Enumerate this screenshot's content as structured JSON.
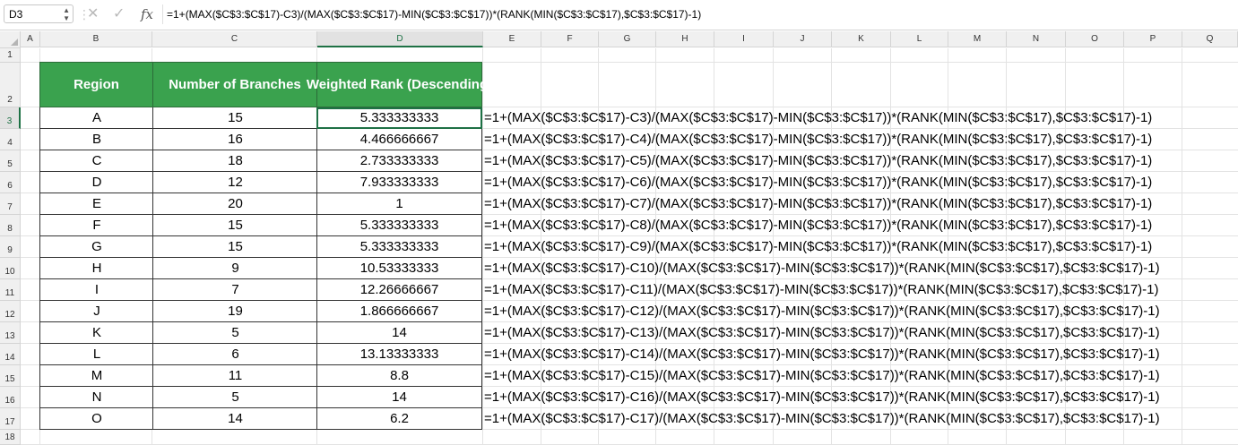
{
  "formula_bar": {
    "name_box": "D3",
    "cancel_icon": "✕",
    "enter_icon": "✓",
    "function_icon": "fx",
    "formula": "=1+(MAX($C$3:$C$17)-C3)/(MAX($C$3:$C$17)-MIN($C$3:$C$17))*(RANK(MIN($C$3:$C$17),$C$3:$C$17)-1)"
  },
  "columns": [
    "A",
    "B",
    "C",
    "D",
    "E",
    "F",
    "G",
    "H",
    "I",
    "J",
    "K",
    "L",
    "M",
    "N",
    "O",
    "P",
    "Q"
  ],
  "selected_column": "D",
  "row_numbers": [
    "1",
    "2",
    "3",
    "4",
    "5",
    "6",
    "7",
    "8",
    "9",
    "10",
    "11",
    "12",
    "13",
    "14",
    "15",
    "16",
    "17",
    "18"
  ],
  "selected_row": "3",
  "table": {
    "headers": {
      "region": "Region",
      "branches": "Number of Branches",
      "rank": "Weighted Rank (Descending)"
    },
    "rows": [
      {
        "region": "A",
        "branches": "15",
        "rank": "5.333333333",
        "formula": "=1+(MAX($C$3:$C$17)-C3)/(MAX($C$3:$C$17)-MIN($C$3:$C$17))*(RANK(MIN($C$3:$C$17),$C$3:$C$17)-1)"
      },
      {
        "region": "B",
        "branches": "16",
        "rank": "4.466666667",
        "formula": "=1+(MAX($C$3:$C$17)-C4)/(MAX($C$3:$C$17)-MIN($C$3:$C$17))*(RANK(MIN($C$3:$C$17),$C$3:$C$17)-1)"
      },
      {
        "region": "C",
        "branches": "18",
        "rank": "2.733333333",
        "formula": "=1+(MAX($C$3:$C$17)-C5)/(MAX($C$3:$C$17)-MIN($C$3:$C$17))*(RANK(MIN($C$3:$C$17),$C$3:$C$17)-1)"
      },
      {
        "region": "D",
        "branches": "12",
        "rank": "7.933333333",
        "formula": "=1+(MAX($C$3:$C$17)-C6)/(MAX($C$3:$C$17)-MIN($C$3:$C$17))*(RANK(MIN($C$3:$C$17),$C$3:$C$17)-1)"
      },
      {
        "region": "E",
        "branches": "20",
        "rank": "1",
        "formula": "=1+(MAX($C$3:$C$17)-C7)/(MAX($C$3:$C$17)-MIN($C$3:$C$17))*(RANK(MIN($C$3:$C$17),$C$3:$C$17)-1)"
      },
      {
        "region": "F",
        "branches": "15",
        "rank": "5.333333333",
        "formula": "=1+(MAX($C$3:$C$17)-C8)/(MAX($C$3:$C$17)-MIN($C$3:$C$17))*(RANK(MIN($C$3:$C$17),$C$3:$C$17)-1)"
      },
      {
        "region": "G",
        "branches": "15",
        "rank": "5.333333333",
        "formula": "=1+(MAX($C$3:$C$17)-C9)/(MAX($C$3:$C$17)-MIN($C$3:$C$17))*(RANK(MIN($C$3:$C$17),$C$3:$C$17)-1)"
      },
      {
        "region": "H",
        "branches": "9",
        "rank": "10.53333333",
        "formula": "=1+(MAX($C$3:$C$17)-C10)/(MAX($C$3:$C$17)-MIN($C$3:$C$17))*(RANK(MIN($C$3:$C$17),$C$3:$C$17)-1)"
      },
      {
        "region": "I",
        "branches": "7",
        "rank": "12.26666667",
        "formula": "=1+(MAX($C$3:$C$17)-C11)/(MAX($C$3:$C$17)-MIN($C$3:$C$17))*(RANK(MIN($C$3:$C$17),$C$3:$C$17)-1)"
      },
      {
        "region": "J",
        "branches": "19",
        "rank": "1.866666667",
        "formula": "=1+(MAX($C$3:$C$17)-C12)/(MAX($C$3:$C$17)-MIN($C$3:$C$17))*(RANK(MIN($C$3:$C$17),$C$3:$C$17)-1)"
      },
      {
        "region": "K",
        "branches": "5",
        "rank": "14",
        "formula": "=1+(MAX($C$3:$C$17)-C13)/(MAX($C$3:$C$17)-MIN($C$3:$C$17))*(RANK(MIN($C$3:$C$17),$C$3:$C$17)-1)"
      },
      {
        "region": "L",
        "branches": "6",
        "rank": "13.13333333",
        "formula": "=1+(MAX($C$3:$C$17)-C14)/(MAX($C$3:$C$17)-MIN($C$3:$C$17))*(RANK(MIN($C$3:$C$17),$C$3:$C$17)-1)"
      },
      {
        "region": "M",
        "branches": "11",
        "rank": "8.8",
        "formula": "=1+(MAX($C$3:$C$17)-C15)/(MAX($C$3:$C$17)-MIN($C$3:$C$17))*(RANK(MIN($C$3:$C$17),$C$3:$C$17)-1)"
      },
      {
        "region": "N",
        "branches": "5",
        "rank": "14",
        "formula": "=1+(MAX($C$3:$C$17)-C16)/(MAX($C$3:$C$17)-MIN($C$3:$C$17))*(RANK(MIN($C$3:$C$17),$C$3:$C$17)-1)"
      },
      {
        "region": "O",
        "branches": "14",
        "rank": "6.2",
        "formula": "=1+(MAX($C$3:$C$17)-C17)/(MAX($C$3:$C$17)-MIN($C$3:$C$17))*(RANK(MIN($C$3:$C$17),$C$3:$C$17)-1)"
      }
    ]
  },
  "colors": {
    "header_fill": "#3aa24e",
    "header_text": "#ffffff",
    "selection": "#1e7145"
  }
}
